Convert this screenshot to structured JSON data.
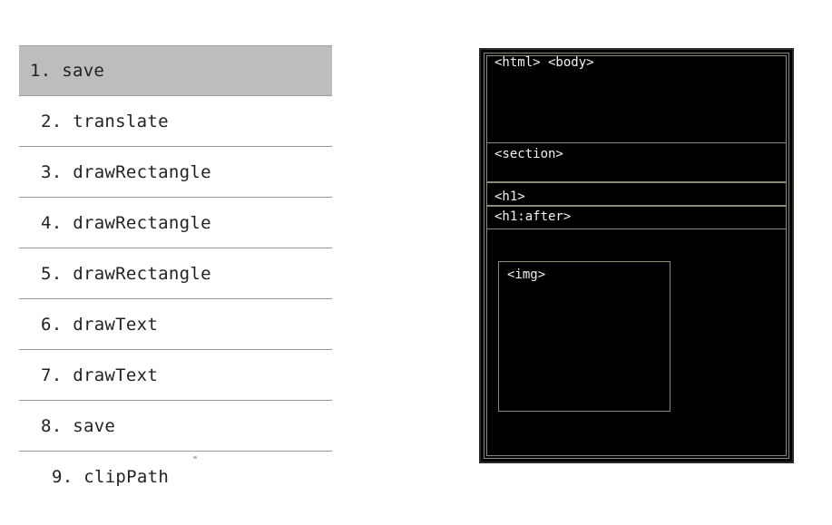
{
  "ops": [
    {
      "label": "1. save"
    },
    {
      "label": "2. translate"
    },
    {
      "label": "3. drawRectangle"
    },
    {
      "label": "4. drawRectangle"
    },
    {
      "label": "5. drawRectangle"
    },
    {
      "label": "6. drawText"
    },
    {
      "label": "7. drawText"
    },
    {
      "label": "8. save"
    },
    {
      "label": "9. clipPath"
    }
  ],
  "diagram": {
    "html_body_label": "<html> <body>",
    "section_label": "<section>",
    "h1_label": "<h1>",
    "h1_after_label": "<h1:after>",
    "img_label": "<img>"
  }
}
